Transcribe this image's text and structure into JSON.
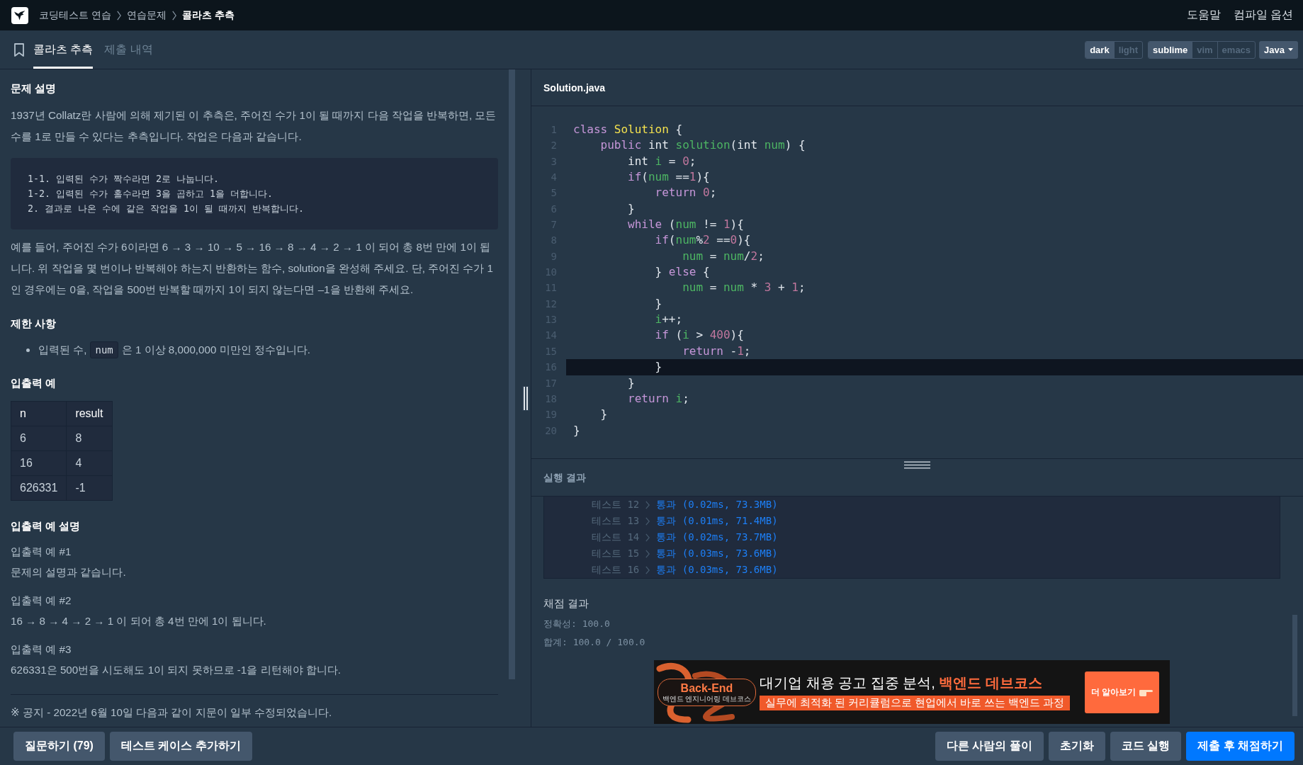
{
  "top_bar": {
    "breadcrumb": [
      {
        "label": "코딩테스트 연습",
        "current": false
      },
      {
        "label": "연습문제",
        "current": false
      },
      {
        "label": "콜라츠 추측",
        "current": true
      }
    ],
    "links": [
      "도움말",
      "컴파일 옵션"
    ]
  },
  "tabs": [
    {
      "label": "콜라츠 추측",
      "selected": true
    },
    {
      "label": "제출 내역",
      "selected": false
    }
  ],
  "editor_options": {
    "theme": [
      {
        "label": "dark",
        "selected": true
      },
      {
        "label": "light",
        "selected": false
      }
    ],
    "keymap": [
      {
        "label": "sublime",
        "selected": true
      },
      {
        "label": "vim",
        "selected": false
      },
      {
        "label": "emacs",
        "selected": false
      }
    ],
    "language": "Java"
  },
  "problem": {
    "description_title": "문제 설명",
    "intro": "1937년 Collatz란 사람에 의해 제기된 이 추측은, 주어진 수가 1이 될 때까지 다음 작업을 반복하면, 모든 수를 1로 만들 수 있다는 추측입니다. 작업은 다음과 같습니다.",
    "steps": [
      "1-1. 입력된 수가 짝수라면 2로 나눕니다.",
      "1-2. 입력된 수가 홀수라면 3을 곱하고 1을 더합니다.",
      "2. 결과로 나온 수에 같은 작업을 1이 될 때까지 반복합니다."
    ],
    "example_text": "예를 들어, 주어진 수가 6이라면 6 → 3 → 10 → 5 → 16 → 8 → 4 → 2 → 1 이 되어 총 8번 만에 1이 됩니다. 위 작업을 몇 번이나 반복해야 하는지 반환하는 함수, solution을 완성해 주세요. 단, 주어진 수가 1인 경우에는 0을, 작업을 500번 반복할 때까지 1이 되지 않는다면 –1을 반환해 주세요.",
    "constraints_title": "제한 사항",
    "constraints": [
      {
        "parts": [
          {
            "kind": "text",
            "text": "입력된 수,"
          },
          {
            "kind": "code",
            "text": "num"
          },
          {
            "kind": "text",
            "text": "은 1 이상 8,000,000 미만인 정수입니다."
          }
        ]
      }
    ],
    "examples_title": "입출력 예",
    "examples_table": {
      "columns": [
        "n",
        "result"
      ],
      "rows": [
        [
          "6",
          "8"
        ],
        [
          "16",
          "4"
        ],
        [
          "626331",
          "-1"
        ]
      ]
    },
    "explanations_title": "입출력 예 설명",
    "explanations": [
      {
        "title": "입출력 예 #1",
        "text": "문제의 설명과 같습니다."
      },
      {
        "title": "입출력 예 #2",
        "text": "16 → 8 → 4 → 2 → 1 이 되어 총 4번 만에 1이 됩니다."
      },
      {
        "title": "입출력 예 #3",
        "text": "626331은 500번을 시도해도 1이 되지 못하므로 -1을 리턴해야 합니다."
      }
    ],
    "notice": "※ 공지 - 2022년 6월 10일 다음과 같이 지문이 일부 수정되었습니다."
  },
  "editor": {
    "filename": "Solution.java",
    "lines": [
      {
        "number": "1",
        "current": false,
        "tokens": [
          {
            "kind": "keyword",
            "text": "class "
          },
          {
            "kind": "class",
            "text": "Solution"
          },
          {
            "kind": "punct",
            "text": " {"
          }
        ]
      },
      {
        "number": "2",
        "current": false,
        "tokens": [
          {
            "kind": "keyword",
            "text": "    public "
          },
          {
            "kind": "type",
            "text": "int "
          },
          {
            "kind": "function",
            "text": "solution"
          },
          {
            "kind": "punct",
            "text": "("
          },
          {
            "kind": "type",
            "text": "int "
          },
          {
            "kind": "variable",
            "text": "num"
          },
          {
            "kind": "punct",
            "text": ") {"
          }
        ]
      },
      {
        "number": "3",
        "current": false,
        "tokens": [
          {
            "kind": "type",
            "text": "        int "
          },
          {
            "kind": "variable",
            "text": "i"
          },
          {
            "kind": "punct",
            "text": " = "
          },
          {
            "kind": "number",
            "text": "0"
          },
          {
            "kind": "punct",
            "text": ";"
          }
        ]
      },
      {
        "number": "4",
        "current": false,
        "tokens": [
          {
            "kind": "keyword",
            "text": "        if"
          },
          {
            "kind": "punct",
            "text": "("
          },
          {
            "kind": "variable",
            "text": "num"
          },
          {
            "kind": "punct",
            "text": " =="
          },
          {
            "kind": "number",
            "text": "1"
          },
          {
            "kind": "punct",
            "text": "){"
          }
        ]
      },
      {
        "number": "5",
        "current": false,
        "tokens": [
          {
            "kind": "keyword",
            "text": "            return "
          },
          {
            "kind": "number",
            "text": "0"
          },
          {
            "kind": "punct",
            "text": ";"
          }
        ]
      },
      {
        "number": "6",
        "current": false,
        "tokens": [
          {
            "kind": "punct",
            "text": "        }"
          }
        ]
      },
      {
        "number": "7",
        "current": false,
        "tokens": [
          {
            "kind": "keyword",
            "text": "        while "
          },
          {
            "kind": "punct",
            "text": "("
          },
          {
            "kind": "variable",
            "text": "num"
          },
          {
            "kind": "punct",
            "text": " != "
          },
          {
            "kind": "number",
            "text": "1"
          },
          {
            "kind": "punct",
            "text": "){"
          }
        ]
      },
      {
        "number": "8",
        "current": false,
        "tokens": [
          {
            "kind": "keyword",
            "text": "            if"
          },
          {
            "kind": "punct",
            "text": "("
          },
          {
            "kind": "variable",
            "text": "num"
          },
          {
            "kind": "punct",
            "text": "%"
          },
          {
            "kind": "number",
            "text": "2"
          },
          {
            "kind": "punct",
            "text": " =="
          },
          {
            "kind": "number",
            "text": "0"
          },
          {
            "kind": "punct",
            "text": "){"
          }
        ]
      },
      {
        "number": "9",
        "current": false,
        "tokens": [
          {
            "kind": "variable",
            "text": "                num"
          },
          {
            "kind": "punct",
            "text": " = "
          },
          {
            "kind": "variable",
            "text": "num"
          },
          {
            "kind": "punct",
            "text": "/"
          },
          {
            "kind": "number",
            "text": "2"
          },
          {
            "kind": "punct",
            "text": ";"
          }
        ]
      },
      {
        "number": "10",
        "current": false,
        "tokens": [
          {
            "kind": "punct",
            "text": "            } "
          },
          {
            "kind": "keyword",
            "text": "else"
          },
          {
            "kind": "punct",
            "text": " {"
          }
        ]
      },
      {
        "number": "11",
        "current": false,
        "tokens": [
          {
            "kind": "variable",
            "text": "                num"
          },
          {
            "kind": "punct",
            "text": " = "
          },
          {
            "kind": "variable",
            "text": "num"
          },
          {
            "kind": "punct",
            "text": " * "
          },
          {
            "kind": "number",
            "text": "3"
          },
          {
            "kind": "punct",
            "text": " + "
          },
          {
            "kind": "number",
            "text": "1"
          },
          {
            "kind": "punct",
            "text": ";"
          }
        ]
      },
      {
        "number": "12",
        "current": false,
        "tokens": [
          {
            "kind": "punct",
            "text": "            }"
          }
        ]
      },
      {
        "number": "13",
        "current": false,
        "tokens": [
          {
            "kind": "variable",
            "text": "            i"
          },
          {
            "kind": "punct",
            "text": "++;"
          }
        ]
      },
      {
        "number": "14",
        "current": false,
        "tokens": [
          {
            "kind": "keyword",
            "text": "            if "
          },
          {
            "kind": "punct",
            "text": "("
          },
          {
            "kind": "variable",
            "text": "i"
          },
          {
            "kind": "punct",
            "text": " > "
          },
          {
            "kind": "number",
            "text": "400"
          },
          {
            "kind": "punct",
            "text": "){"
          }
        ]
      },
      {
        "number": "15",
        "current": false,
        "tokens": [
          {
            "kind": "keyword",
            "text": "                return "
          },
          {
            "kind": "punct",
            "text": "-"
          },
          {
            "kind": "number",
            "text": "1"
          },
          {
            "kind": "punct",
            "text": ";"
          }
        ]
      },
      {
        "number": "16",
        "current": true,
        "tokens": [
          {
            "kind": "punct",
            "text": "            }"
          }
        ]
      },
      {
        "number": "17",
        "current": false,
        "tokens": [
          {
            "kind": "punct",
            "text": "        }"
          }
        ]
      },
      {
        "number": "18",
        "current": false,
        "tokens": [
          {
            "kind": "keyword",
            "text": "        return "
          },
          {
            "kind": "variable",
            "text": "i"
          },
          {
            "kind": "punct",
            "text": ";"
          }
        ]
      },
      {
        "number": "19",
        "current": false,
        "tokens": [
          {
            "kind": "punct",
            "text": "    }"
          }
        ]
      },
      {
        "number": "20",
        "current": false,
        "tokens": [
          {
            "kind": "punct",
            "text": "}"
          }
        ]
      }
    ]
  },
  "results": {
    "title": "실행 결과",
    "tests": [
      {
        "label": "테스트 12",
        "result": "통과 (0.02ms, 73.3MB)",
        "passed": true
      },
      {
        "label": "테스트 13",
        "result": "통과 (0.01ms, 71.4MB)",
        "passed": true
      },
      {
        "label": "테스트 14",
        "result": "통과 (0.02ms, 73.7MB)",
        "passed": true
      },
      {
        "label": "테스트 15",
        "result": "통과 (0.03ms, 73.6MB)",
        "passed": true
      },
      {
        "label": "테스트 16",
        "result": "통과 (0.03ms, 73.6MB)",
        "passed": true
      }
    ],
    "grading": {
      "title": "채점 결과",
      "lines": [
        "정확성: 100.0",
        "합계: 100.0 / 100.0"
      ]
    }
  },
  "ad": {
    "logo": "Back-End",
    "logo_caption": "백엔드 엔지니어링 데브코스",
    "headline": "대기업 채용 공고 집중 분석, **백엔드 데브코스**",
    "subline": "실무에 최적화 된 커리큘럼으로 현업에서 바로 쓰는 백엔드 과정",
    "cta": "더 알아보기"
  },
  "bottom_bar": {
    "left_buttons": [
      {
        "label": "질문하기 (79)",
        "kind": "secondary"
      },
      {
        "label": "테스트 케이스 추가하기",
        "kind": "secondary"
      }
    ],
    "right_buttons": [
      {
        "label": "다른 사람의 풀이",
        "kind": "secondary"
      },
      {
        "label": "초기화",
        "kind": "secondary"
      },
      {
        "label": "코드 실행",
        "kind": "secondary"
      },
      {
        "label": "제출 후 채점하기",
        "kind": "primary"
      }
    ]
  }
}
